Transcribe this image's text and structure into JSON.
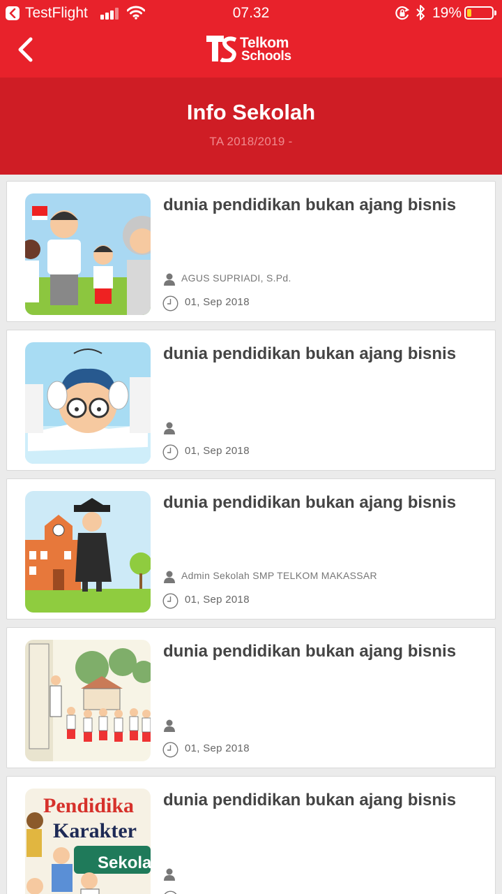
{
  "status_bar": {
    "app_name": "TestFlight",
    "time": "07.32",
    "battery_percent": "19%",
    "battery_level": 0.19,
    "icons": [
      "back-to-app-icon",
      "signal-icon",
      "wifi-icon",
      "rotation-lock-icon",
      "bluetooth-icon",
      "battery-icon"
    ]
  },
  "nav": {
    "back_icon": "chevron-left-icon",
    "brand_line1": "Telkom",
    "brand_line2": "Schools"
  },
  "header": {
    "title": "Info Sekolah",
    "subtitle": "TA 2018/2019 -"
  },
  "colors": {
    "primary_red": "#e8222b",
    "header_red": "#cf1d25",
    "title_text": "#444444"
  },
  "posts": [
    {
      "title": "dunia pendidikan bukan ajang bisnis",
      "author": "AGUS SUPRIADI, S.Pd.",
      "date": "01, Sep 2018"
    },
    {
      "title": "dunia pendidikan bukan ajang bisnis",
      "author": "",
      "date": "01, Sep 2018"
    },
    {
      "title": "dunia pendidikan bukan ajang bisnis",
      "author": "Admin Sekolah SMP TELKOM MAKASSAR",
      "date": "01, Sep 2018"
    },
    {
      "title": "dunia pendidikan bukan ajang bisnis",
      "author": "",
      "date": "01, Sep 2018"
    },
    {
      "title": "dunia pendidikan bukan ajang bisnis",
      "author": "",
      "date": ""
    }
  ],
  "post_thumb_text": {
    "line1": "Pendidika",
    "line2": "Karakter",
    "line3": "Sekolah"
  }
}
